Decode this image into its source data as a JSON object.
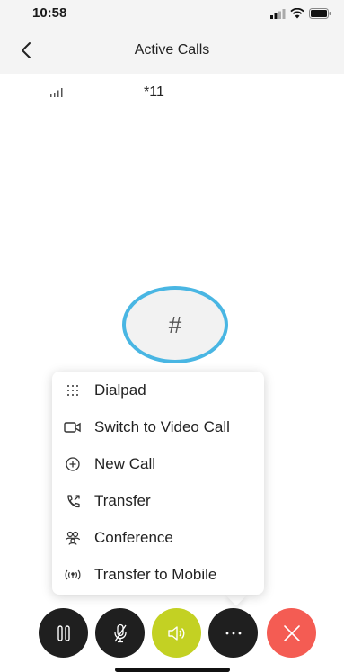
{
  "status": {
    "time": "10:58"
  },
  "header": {
    "title": "Active Calls"
  },
  "call": {
    "number": "*11",
    "avatar_text": "#"
  },
  "menu": {
    "items": [
      {
        "label": "Dialpad",
        "icon": "dialpad-icon"
      },
      {
        "label": "Switch to Video Call",
        "icon": "video-icon"
      },
      {
        "label": "New Call",
        "icon": "plus-circle-icon"
      },
      {
        "label": "Transfer",
        "icon": "transfer-icon"
      },
      {
        "label": "Conference",
        "icon": "conference-icon"
      },
      {
        "label": "Transfer to Mobile",
        "icon": "mobile-signal-icon"
      }
    ]
  },
  "controls": {
    "buttons": [
      {
        "name": "hold",
        "icon": "pause-icon",
        "color": "#1f1f1f"
      },
      {
        "name": "mute",
        "icon": "mic-off-icon",
        "color": "#1f1f1f"
      },
      {
        "name": "speaker",
        "icon": "speaker-icon",
        "color": "#c3d123"
      },
      {
        "name": "more",
        "icon": "more-icon",
        "color": "#1f1f1f"
      },
      {
        "name": "end-call",
        "icon": "close-icon",
        "color": "#f45c53"
      }
    ]
  },
  "colors": {
    "accent_ring": "#49b6e3",
    "speaker_active": "#c3d123",
    "end_call": "#f45c53"
  }
}
